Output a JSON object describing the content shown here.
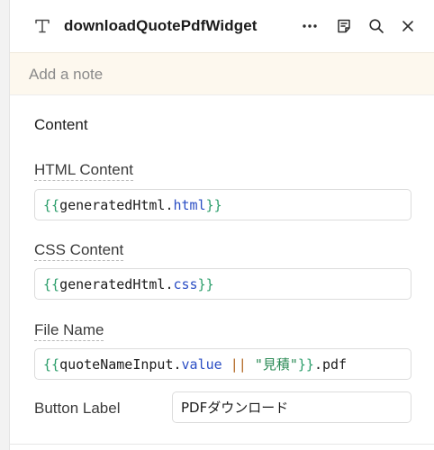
{
  "header": {
    "title": "downloadQuotePdfWidget",
    "type_icon": "text-type-icon",
    "actions": [
      "more-icon",
      "notes-icon",
      "search-icon",
      "close-icon"
    ]
  },
  "note": {
    "placeholder": "Add a note"
  },
  "content": {
    "section_title": "Content",
    "html_label": "HTML Content",
    "html_value": {
      "open": "{{ ",
      "ident": "generatedHtml",
      "dot": ".",
      "prop": "html",
      "close": " }}"
    },
    "css_label": "CSS Content",
    "css_value": {
      "open": "{{ ",
      "ident": "generatedHtml",
      "dot": ".",
      "prop": "css",
      "close": " }}"
    },
    "filename_label": "File Name",
    "filename_value": {
      "open": "{{",
      "ident": "quoteNameInput",
      "dot": ".",
      "prop": "value",
      "op": " || ",
      "str": "\"見積\"",
      "close": "}}",
      "suffix": ".pdf"
    },
    "button_label_label": "Button Label",
    "button_label_value": "PDFダウンロード"
  }
}
